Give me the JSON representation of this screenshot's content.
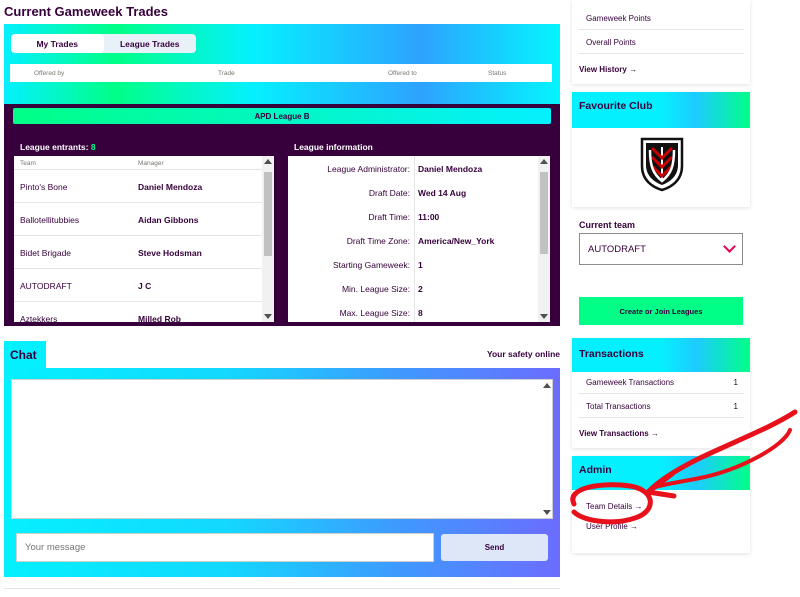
{
  "trades": {
    "title": "Current Gameweek Trades",
    "tabs": [
      "My Trades",
      "League Trades"
    ],
    "columns": [
      "Offered by",
      "Trade",
      "Offered to",
      "Status"
    ]
  },
  "league": {
    "name": "APD League B",
    "entrants_label": "League entrants:",
    "entrants_count": "8",
    "entrants_columns": [
      "Team",
      "Manager"
    ],
    "entrants": [
      {
        "team": "Pinto's Bone",
        "manager": "Daniel Mendoza"
      },
      {
        "team": "Ballotellitubbies",
        "manager": "Aidan Gibbons"
      },
      {
        "team": "Bidet Brigade",
        "manager": "Steve Hodsman"
      },
      {
        "team": "AUTODRAFT",
        "manager": "J C"
      },
      {
        "team": "Aztekkers",
        "manager": "Milled Rob"
      }
    ],
    "info_title": "League information",
    "info": [
      {
        "label": "League Administrator:",
        "value": "Daniel Mendoza"
      },
      {
        "label": "Draft Date:",
        "value": "Wed 14 Aug"
      },
      {
        "label": "Draft Time:",
        "value": "11:00"
      },
      {
        "label": "Draft Time Zone:",
        "value": "America/New_York"
      },
      {
        "label": "Starting Gameweek:",
        "value": "1"
      },
      {
        "label": "Min. League Size:",
        "value": "2"
      },
      {
        "label": "Max. League Size:",
        "value": "8"
      }
    ]
  },
  "chat": {
    "tab_label": "Chat",
    "safety_link": "Your safety online",
    "message_placeholder": "Your message",
    "send_label": "Send"
  },
  "sidebar": {
    "points_items": [
      "Gameweek Points",
      "Overall Points"
    ],
    "view_history": "View History →",
    "favourite_club_title": "Favourite Club",
    "current_team_label": "Current team",
    "current_team_value": "AUTODRAFT",
    "create_join_label": "Create or Join Leagues",
    "transactions_title": "Transactions",
    "transactions": [
      {
        "label": "Gameweek Transactions",
        "value": "1"
      },
      {
        "label": "Total Transactions",
        "value": "1"
      }
    ],
    "view_transactions": "View Transactions →",
    "admin_title": "Admin",
    "team_details": "Team Details →",
    "user_profile": "User Profile →"
  },
  "colors": {
    "primary": "#37003c",
    "accent_green": "#00ff87",
    "accent_cyan": "#05f0ff",
    "accent_pink": "#e90052",
    "annotation_red": "#e8101a"
  },
  "icons": {
    "club_crest": "fulham-crest-icon",
    "dropdown": "chevron-down-icon"
  }
}
